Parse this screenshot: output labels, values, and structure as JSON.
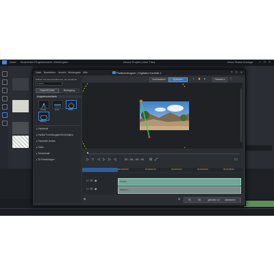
{
  "app": {
    "title": "Neues Projekt (ohne Titel)",
    "menu": [
      "Datei",
      "Bearbeiten",
      "Plugins",
      "Ansicht",
      "Wiedergabe"
    ],
    "right_text": "Neue Status Anzeige"
  },
  "dialog": {
    "menu": [
      "Datei",
      "Bearbeiten",
      "Ansicht",
      "Wiedergabe",
      "Hilfe"
    ],
    "title": "Partikeldesigner | Digitales Konfetti 2",
    "panel": {
      "hint": "Wählen Sie einen Partikel aus, der bearbeitet",
      "search_value": "Partikel",
      "tabs": [
        "Objekt/Emitter",
        "Bewegung"
      ],
      "section": "Ausgabevorschlaufe",
      "presets": [
        {
          "label": "Punkt",
          "selected": false
        },
        {
          "label": "Linie",
          "selected": false
        },
        {
          "label": "Kreis",
          "selected": true
        },
        {
          "label": "Ellipse",
          "selected": true
        }
      ],
      "settings": [
        "Partikelstil",
        "Partikel Form/Ausgabe/Größe/Alpha",
        "Parameter ändern",
        "Farbe",
        "Schwerkraft",
        "3D Einstellungen"
      ]
    },
    "toolbar": {
      "buttons": [
        "Zurücksetzen",
        "Speichern"
      ],
      "zoom": "Passend"
    },
    "playback": {
      "timecode": "00 ; 00 ; 00 ; 00"
    },
    "ruler": [
      "00;00;00;00",
      "00;00;02;00",
      "00;00;04;00",
      "00;00;06;00",
      "00;00;08;00"
    ],
    "tracks": [
      {
        "label": "Partikel"
      },
      {
        "label": "Partikel 1"
      }
    ],
    "footer": [
      "Teilen",
      "Speichern unter",
      "OK",
      "Abbrechen"
    ]
  },
  "colors": {
    "accent": "#3d8be0",
    "guide": "#d6d23a",
    "track1": "#6fa898",
    "track2": "#7a8d8a"
  }
}
